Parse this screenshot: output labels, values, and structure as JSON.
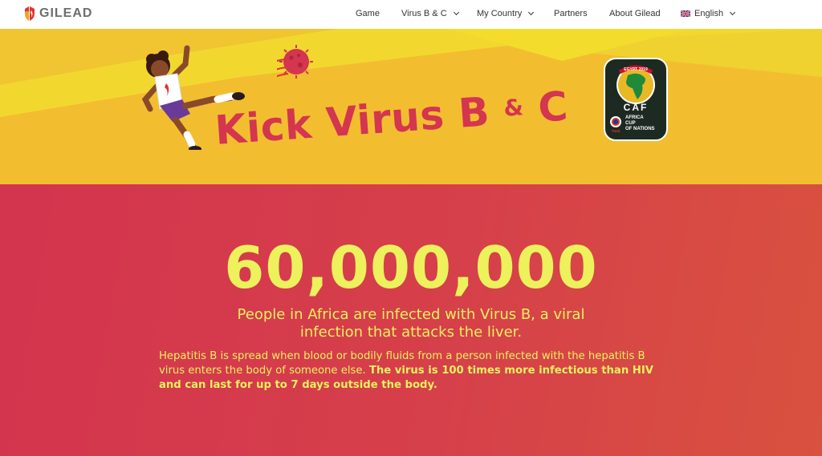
{
  "brand": {
    "name": "GILEAD"
  },
  "nav": {
    "items": [
      {
        "label": "Game",
        "has_dropdown": false
      },
      {
        "label": "Virus B & C",
        "has_dropdown": true
      },
      {
        "label": "My Country",
        "has_dropdown": true
      },
      {
        "label": "Partners",
        "has_dropdown": false
      },
      {
        "label": "About Gilead",
        "has_dropdown": false
      },
      {
        "label": "English",
        "has_dropdown": true,
        "icon": "uk-flag-icon"
      }
    ]
  },
  "banner": {
    "title_main": "Kick Virus B",
    "title_amp": "&",
    "title_end": "C",
    "badge": {
      "top_text": "EGYPT 2019",
      "letters": "CAF",
      "lines": [
        "AFRICA",
        "CUP",
        "OF NATIONS"
      ],
      "sponsor": "Total"
    }
  },
  "main": {
    "stat": "60,000,000",
    "subtitle": "People in Africa are infected with Virus B, a viral infection that attacks the liver.",
    "paragraph_normal": "Hepatitis B is spread when blood or bodily fluids from a person infected with the hepatitis B virus enters the body of someone else. ",
    "paragraph_bold": "The virus is 100 times more infectious than HIV and can last for up to 7 days outside the body."
  },
  "colors": {
    "banner_yellow": "#f2d82e",
    "banner_orange": "#f2b830",
    "title_red": "#d4354f",
    "main_red": "#d6404a",
    "stat_yellow": "#ecf15c"
  }
}
